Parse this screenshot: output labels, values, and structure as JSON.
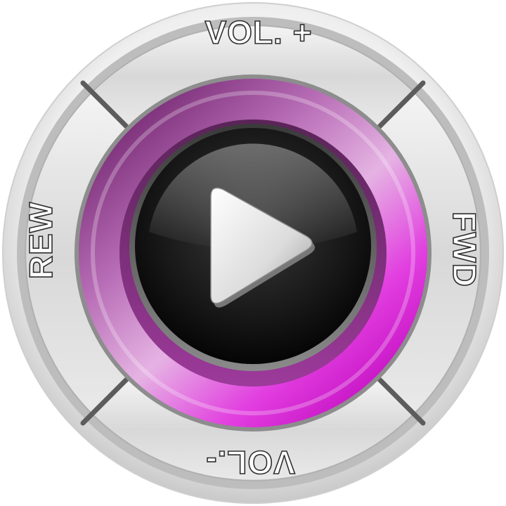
{
  "controls": {
    "vol_up_label": "VOL. +",
    "fwd_label": "FWD",
    "vol_down_label": "VOL.-",
    "rew_label": "REW"
  },
  "icons": {
    "center": "play-icon"
  },
  "colors": {
    "ring_accent": "#d81fd6",
    "ring_dark": "#7a2e78",
    "ring_light": "#f1d2ef",
    "segment_face": "#d9d9d9",
    "play_button": "#1a1a1a",
    "play_icon": "#e6e6e6"
  }
}
